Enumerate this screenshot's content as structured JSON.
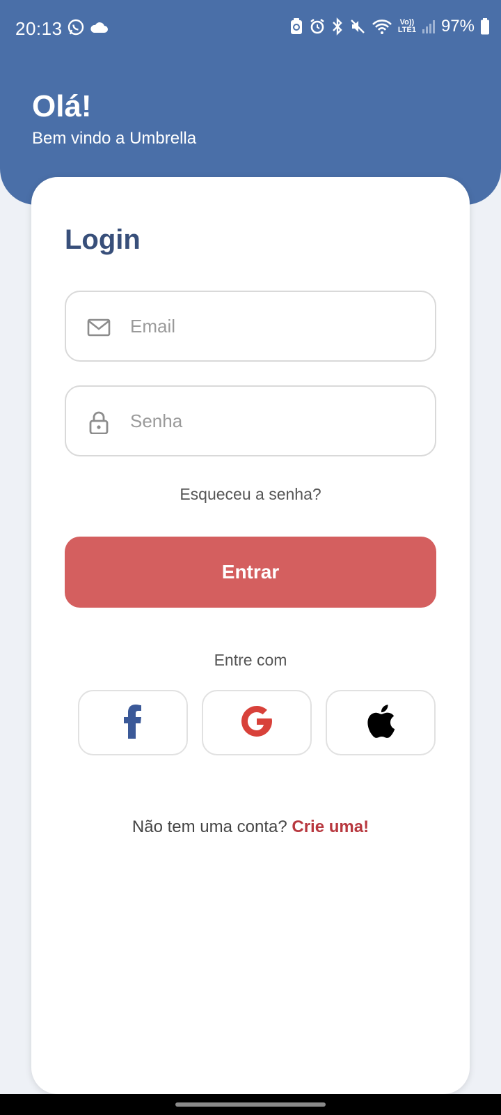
{
  "status_bar": {
    "time": "20:13",
    "battery_percent": "97%",
    "network_label_top": "Vo))",
    "network_label_bottom": "LTE1",
    "left_icons": [
      "whatsapp-icon",
      "cloud-icon"
    ],
    "right_icons": [
      "battery-saver-icon",
      "alarm-icon",
      "bluetooth-icon",
      "mute-icon",
      "wifi-icon",
      "volte-icon",
      "signal-icon",
      "battery-icon"
    ]
  },
  "header": {
    "title": "Olá!",
    "subtitle": "Bem vindo a Umbrella",
    "background_color": "#4a6fa8"
  },
  "login": {
    "title": "Login",
    "email_placeholder": "Email",
    "password_placeholder": "Senha",
    "forgot_label": "Esqueceu a senha?",
    "submit_label": "Entrar",
    "submit_color": "#d45f5f",
    "social_label": "Entre com",
    "social_providers": [
      "facebook-icon",
      "google-icon",
      "apple-icon"
    ],
    "signup_prompt": "Não tem uma conta?",
    "signup_link": "Crie uma!",
    "signup_link_color": "#b8383f"
  }
}
